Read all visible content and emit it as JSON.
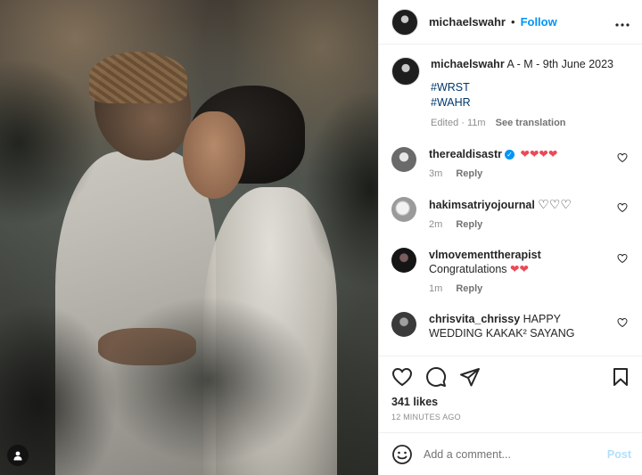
{
  "header": {
    "username": "michaelswahr",
    "separator": "•",
    "follow_label": "Follow",
    "more_label": "•••",
    "more_icon": "more-horizontal-icon"
  },
  "caption": {
    "username": "michaelswahr",
    "text": "A - M - 9th June 2023",
    "hashtags": [
      "#WRST",
      "#WAHR"
    ],
    "edited_label": "Edited",
    "time": "11m",
    "see_translation": "See translation"
  },
  "comments": [
    {
      "username": "therealdisastr",
      "verified": true,
      "verified_icon": "verified-badge-icon",
      "text": "",
      "hearts": "❤❤❤❤",
      "hearts_style": "red",
      "time": "3m",
      "reply": "Reply"
    },
    {
      "username": "hakimsatriyojournal",
      "verified": false,
      "text": "",
      "hearts": "♡♡♡",
      "hearts_style": "outline",
      "time": "2m",
      "reply": "Reply"
    },
    {
      "username": "vlmovementtherapist",
      "verified": false,
      "text": "Congratulations",
      "hearts": "❤❤",
      "hearts_style": "red",
      "time": "1m",
      "reply": "Reply"
    },
    {
      "username": "chrisvita_chrissy",
      "verified": false,
      "text": "HAPPY WEDDING KAKAK² SAYANG",
      "hearts": "",
      "hearts_style": "none",
      "time": "",
      "reply": ""
    }
  ],
  "actions": {
    "icons": [
      "heart-icon",
      "comment-icon",
      "share-icon",
      "bookmark-icon"
    ],
    "likes": "341 likes",
    "timestamp": "12 MINUTES AGO"
  },
  "add_comment": {
    "placeholder": "Add a comment...",
    "post_label": "Post",
    "emoji_icon": "emoji-icon"
  },
  "colors": {
    "accent": "#0095f6",
    "heart_red": "#ed4956",
    "hashtag": "#00376b",
    "muted": "#8e8e8e",
    "post_disabled": "#b2dffc"
  }
}
